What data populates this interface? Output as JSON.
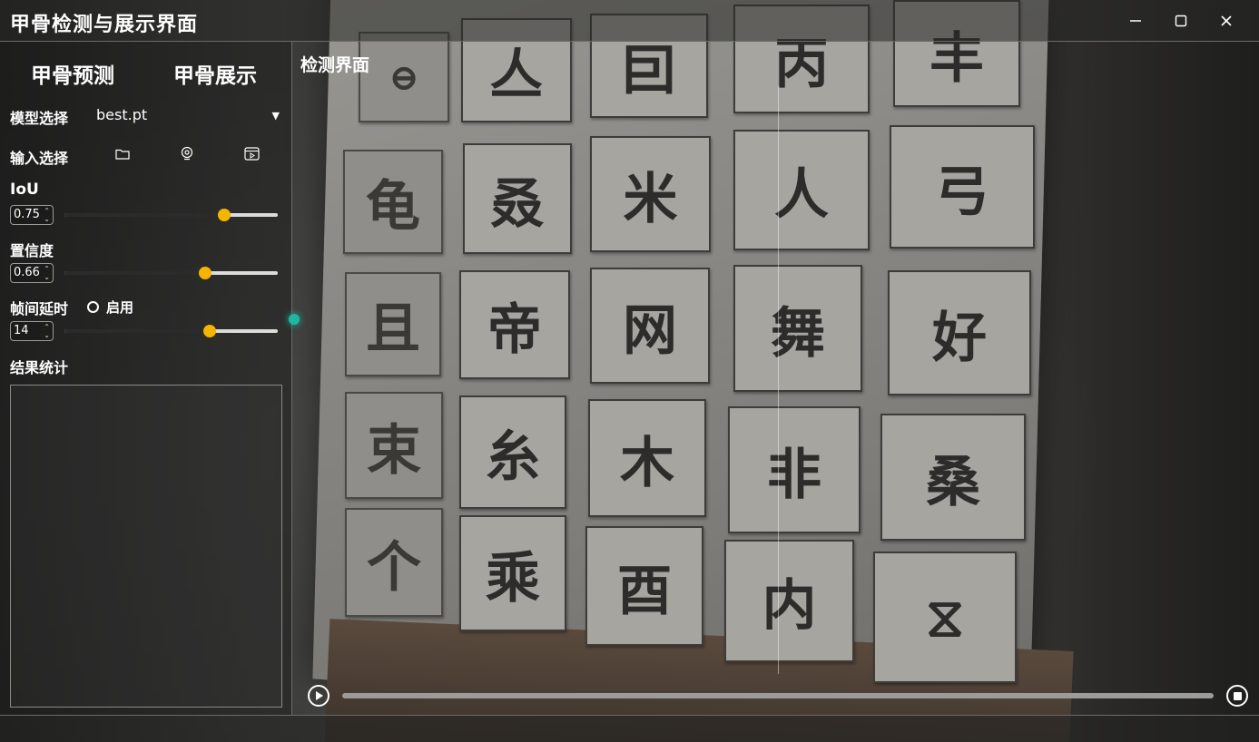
{
  "window": {
    "title": "甲骨检测与展示界面"
  },
  "tabs": {
    "predict": "甲骨预测",
    "show": "甲骨展示"
  },
  "model": {
    "label": "模型选择",
    "value": "best.pt"
  },
  "input": {
    "label": "输入选择",
    "icons": [
      "folder-icon",
      "webcam-icon",
      "video-icon"
    ]
  },
  "iou": {
    "label": "IoU",
    "value": "0.75",
    "level": 0.75
  },
  "confidence": {
    "label": "置信度",
    "value": "0.66",
    "level": 0.66
  },
  "frame_delay": {
    "label": "帧间延时",
    "enable_label": "启用",
    "value": "14",
    "level": 0.68
  },
  "results": {
    "label": "结果统计"
  },
  "main": {
    "title": "检测界面"
  },
  "colors": {
    "accent": "#f4b400",
    "teal": "#1fb7a4"
  }
}
